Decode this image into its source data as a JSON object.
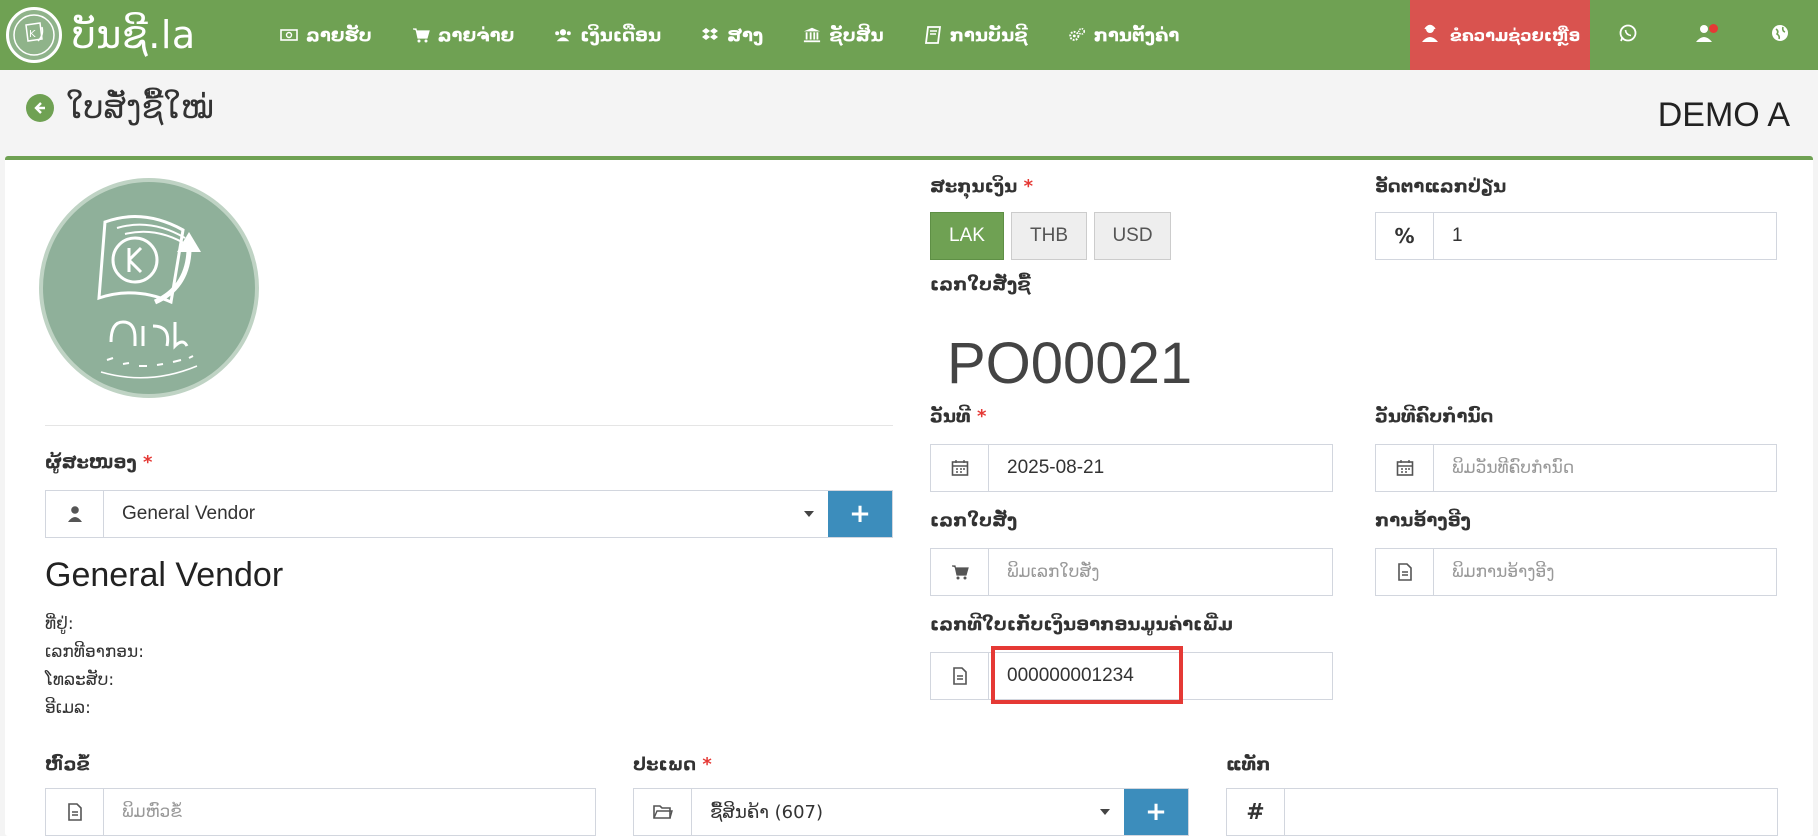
{
  "app": {
    "brand": "ບັນຊີ.la"
  },
  "nav": {
    "items": [
      {
        "label": "ລາຍຮັບ",
        "icon": "money-icon"
      },
      {
        "label": "ລາຍຈ່າຍ",
        "icon": "cart-icon"
      },
      {
        "label": "ເງິນເດືອນ",
        "icon": "users-icon"
      },
      {
        "label": "ສາງ",
        "icon": "dropbox-icon"
      },
      {
        "label": "ຊັບສິນ",
        "icon": "bank-icon"
      },
      {
        "label": "ການບັນຊີ",
        "icon": "book-icon"
      },
      {
        "label": "ການຕັ້ງຄ່າ",
        "icon": "gears-icon"
      }
    ],
    "help_label": "ຂໍຄວາມຊ່ວຍເຫຼືອ"
  },
  "header": {
    "title": "ໃບສັ່ງຊື້ໃໝ່",
    "company": "DEMO A"
  },
  "form": {
    "vendor": {
      "label": "ຜູ້ສະໜອງ",
      "value": "General Vendor",
      "name": "General Vendor",
      "address_label": "ທີ່ຢູ່:",
      "tax_label": "ເລກທີອາກອນ:",
      "phone_label": "ໂທລະສັບ:",
      "email_label": "ອີເມລ:"
    },
    "currency": {
      "label": "ສະກຸນເງິນ",
      "options": [
        "LAK",
        "THB",
        "USD"
      ],
      "selected": "LAK"
    },
    "exchange_rate": {
      "label": "ອັດຕາແລກປ່ຽນ",
      "value": "1",
      "addon": "%"
    },
    "po_number": {
      "label": "ເລກໃບສັ່ງຊື້",
      "value": "PO00021"
    },
    "date": {
      "label": "ວັນທີ",
      "value": "2025-08-21"
    },
    "due_date": {
      "label": "ວັນທີຄົບກຳນົດ",
      "placeholder": "ພິມວັນທີຄົບກຳນົດ"
    },
    "order_number": {
      "label": "ເລກໃບສັ່ງ",
      "placeholder": "ພິມເລກໃບສັ່ງ"
    },
    "reference": {
      "label": "ການອ້າງອີງ",
      "placeholder": "ພິມການອ້າງອີງ"
    },
    "vat_receipt": {
      "label": "ເລກທີໃບເກັບເງິນອາກອນມູນຄ່າເພີ່ມ",
      "value": "000000001234"
    },
    "subject": {
      "label": "ຫົວຂໍ້",
      "placeholder": "ພິມຫົວຂໍ້"
    },
    "category": {
      "label": "ປະເພດ",
      "value": "ຊື້ສິນຄ້າ (607)"
    },
    "tag": {
      "label": "ແທັກ",
      "addon": "#"
    }
  },
  "colors": {
    "navbar": "#6fa153",
    "help": "#d9534f",
    "primary_button": "#3c8dbc",
    "required": "#e53935"
  }
}
